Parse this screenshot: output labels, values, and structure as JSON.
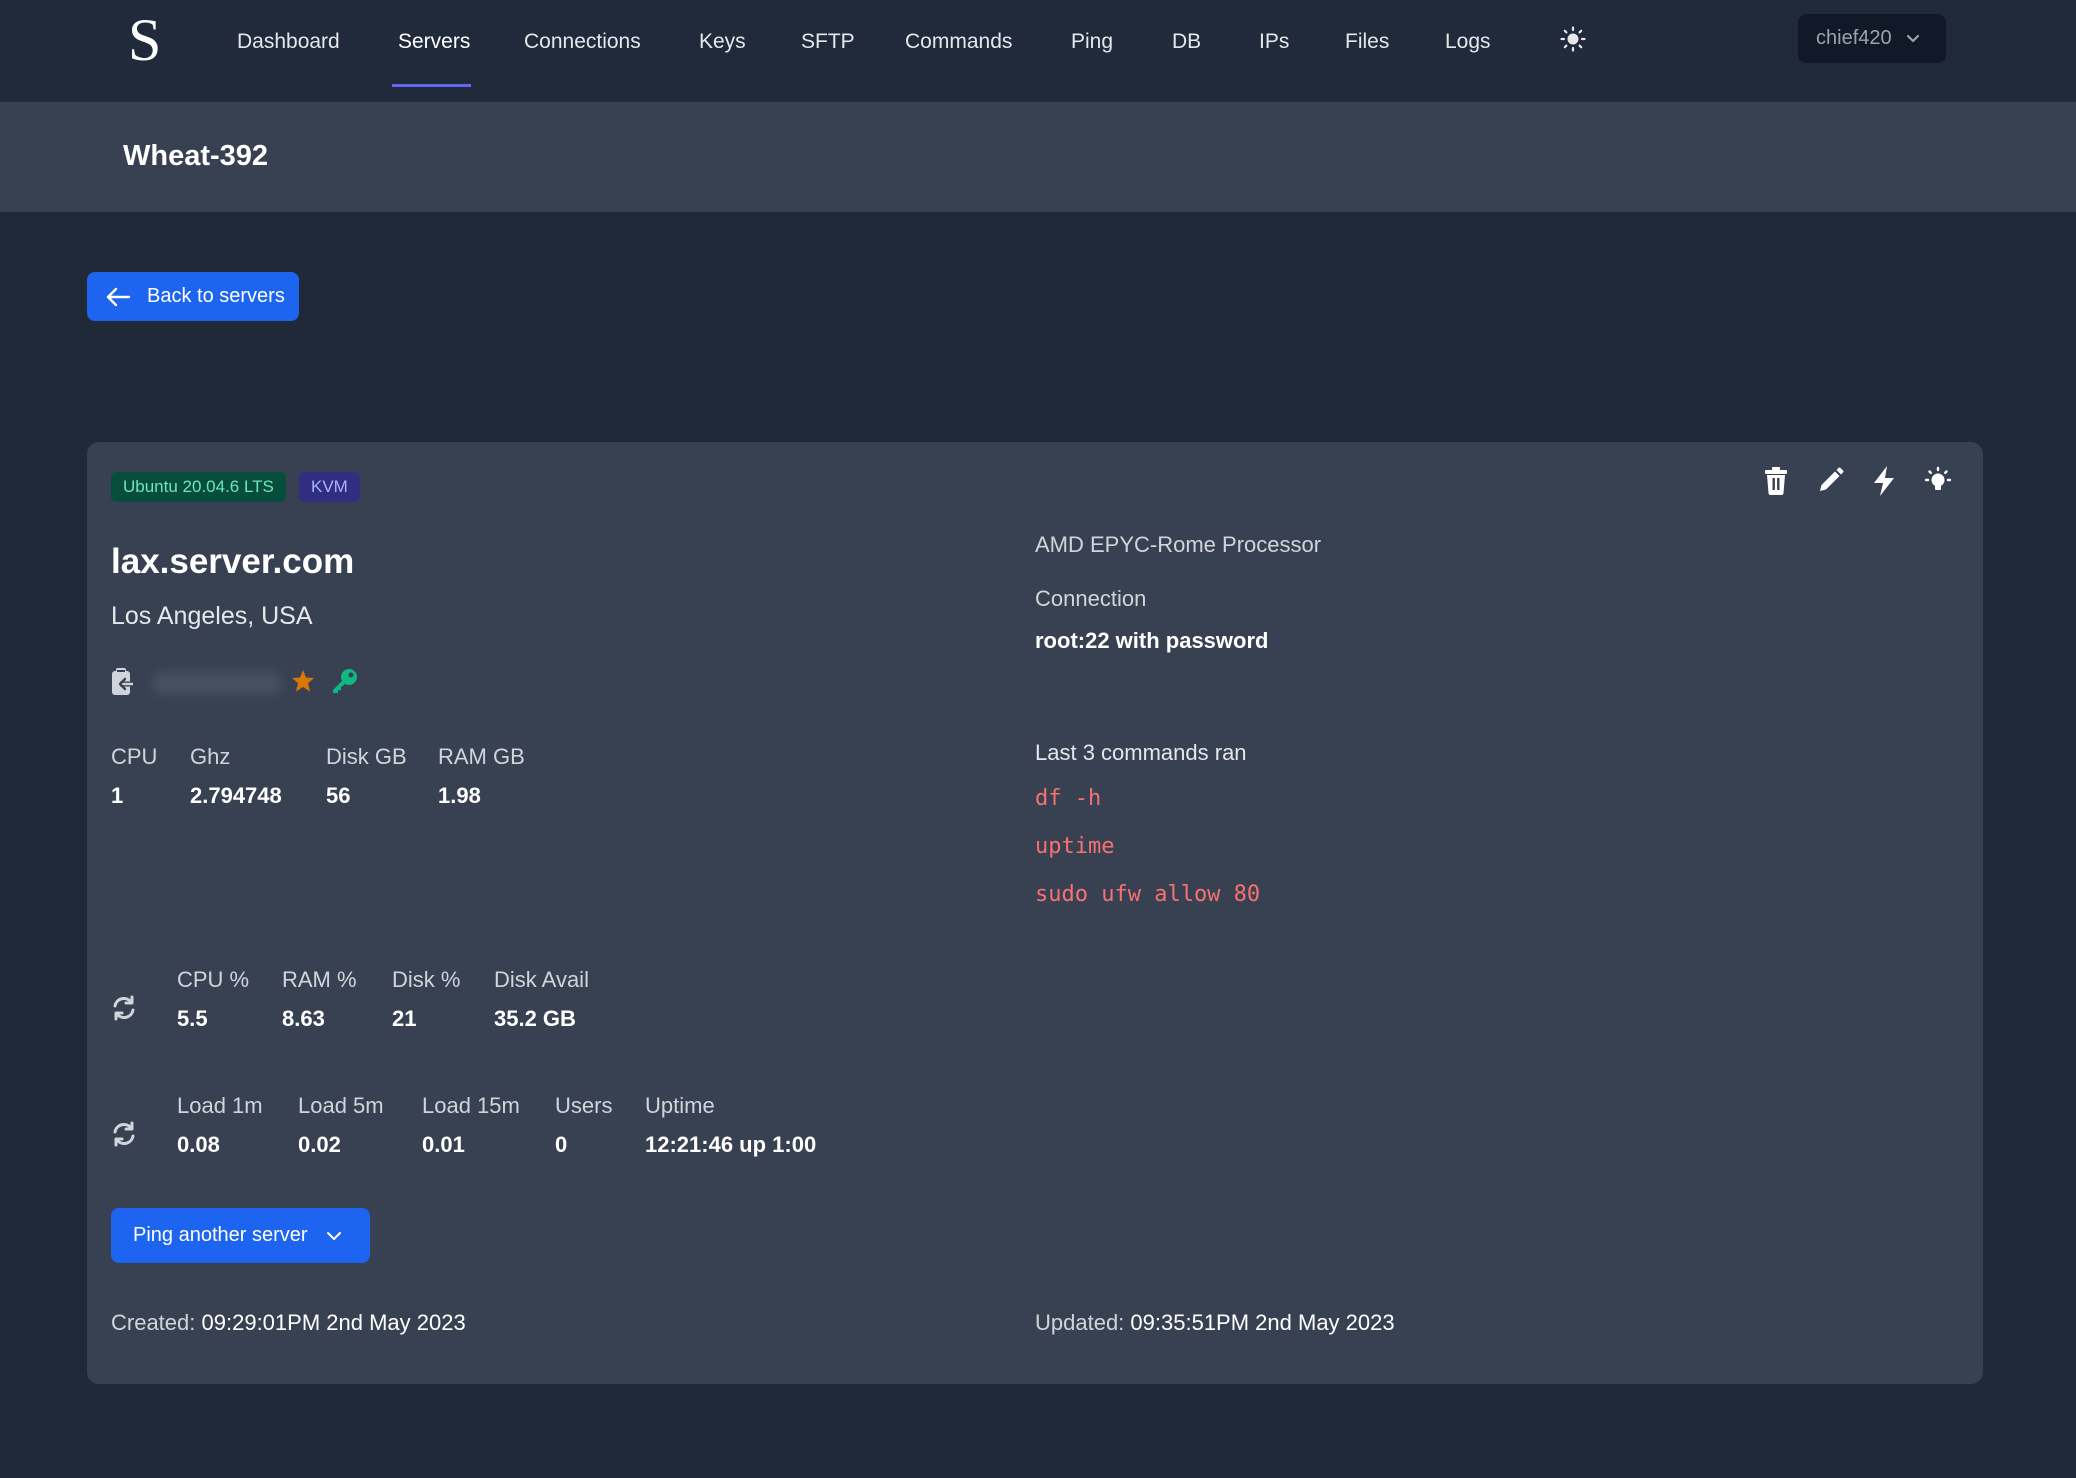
{
  "nav": {
    "logo": "S",
    "items": [
      {
        "label": "Dashboard",
        "active": false
      },
      {
        "label": "Servers",
        "active": true
      },
      {
        "label": "Connections",
        "active": false
      },
      {
        "label": "Keys",
        "active": false
      },
      {
        "label": "SFTP",
        "active": false
      },
      {
        "label": "Commands",
        "active": false
      },
      {
        "label": "Ping",
        "active": false
      },
      {
        "label": "DB",
        "active": false
      },
      {
        "label": "IPs",
        "active": false
      },
      {
        "label": "Files",
        "active": false
      },
      {
        "label": "Logs",
        "active": false
      }
    ],
    "theme_icon": "sun-icon",
    "user": "chief420",
    "accent_color": "#6366f1"
  },
  "header": {
    "title": "Wheat-392"
  },
  "back_button": {
    "label": "Back to servers",
    "icon": "arrow-left-icon"
  },
  "server": {
    "badges": {
      "os": "Ubuntu 20.04.6 LTS",
      "virt": "KVM"
    },
    "actions": [
      "trash-icon",
      "pencil-icon",
      "bolt-icon",
      "lightbulb-icon"
    ],
    "hostname": "lax.server.com",
    "location": "Los Angeles, USA",
    "ip_blurred": true,
    "specs": [
      {
        "label": "CPU",
        "value": "1"
      },
      {
        "label": "Ghz",
        "value": "2.794748"
      },
      {
        "label": "Disk GB",
        "value": "56"
      },
      {
        "label": "RAM GB",
        "value": "1.98"
      }
    ],
    "usage": [
      {
        "label": "CPU %",
        "value": "5.5"
      },
      {
        "label": "RAM %",
        "value": "8.63"
      },
      {
        "label": "Disk %",
        "value": "21"
      },
      {
        "label": "Disk Avail",
        "value": "35.2 GB"
      }
    ],
    "load": [
      {
        "label": "Load 1m",
        "value": "0.08"
      },
      {
        "label": "Load 5m",
        "value": "0.02"
      },
      {
        "label": "Load 15m",
        "value": "0.01"
      },
      {
        "label": "Users",
        "value": "0"
      },
      {
        "label": "Uptime",
        "value": "12:21:46 up 1:00"
      }
    ],
    "processor": "AMD EPYC-Rome Processor",
    "connection_label": "Connection",
    "connection_value": "root:22 with password",
    "commands_title": "Last 3 commands ran",
    "commands": [
      "df -h",
      "uptime",
      "sudo ufw allow 80"
    ],
    "ping_button": "Ping another server",
    "created_label": "Created:",
    "created_value": "09:29:01PM 2nd May 2023",
    "updated_label": "Updated:",
    "updated_value": "09:35:51PM 2nd May 2023"
  }
}
